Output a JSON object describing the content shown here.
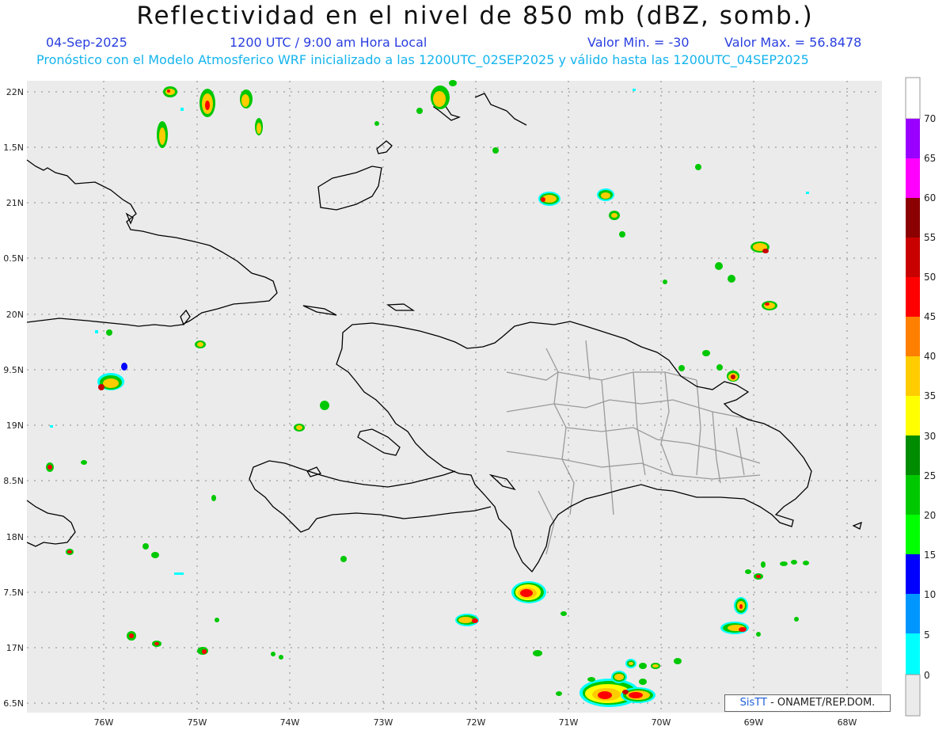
{
  "header": {
    "title": "Reflectividad en el nivel de 850 mb (dBZ, somb.)",
    "date": "04-Sep-2025",
    "time": "1200 UTC / 9:00 am Hora Local",
    "valmin": "Valor Min. = -30",
    "valmax": "Valor Max. = 56.8478",
    "forecast": "Pronóstico con el Modelo Atmosferico WRF inicializado a las 1200UTC_02SEP2025 y válido hasta las  1200UTC_04SEP2025"
  },
  "map": {
    "lat_labels": [
      "22N",
      "1.5N",
      "21N",
      "0.5N",
      "20N",
      "9.5N",
      "19N",
      "8.5N",
      "18N",
      "7.5N",
      "17N",
      "6.5N"
    ],
    "lon_labels": [
      "76W",
      "75W",
      "74W",
      "73W",
      "72W",
      "71W",
      "70W",
      "69W",
      "68W"
    ],
    "background": "#ebebeb",
    "coast_color": "#000000",
    "province_color": "#9a9a9a"
  },
  "colorbar": {
    "levels": [
      "70",
      "65",
      "60",
      "55",
      "50",
      "45",
      "40",
      "35",
      "30",
      "25",
      "20",
      "15",
      "10",
      "5",
      "0"
    ],
    "colors": [
      "#9a00ff",
      "#ff00ff",
      "#8b0000",
      "#c80000",
      "#ff0000",
      "#ff7f00",
      "#ffcc00",
      "#ffff00",
      "#008c00",
      "#00c800",
      "#00ff00",
      "#0000ff",
      "#0096ff",
      "#00ffff",
      "#ebebeb"
    ]
  },
  "credit": {
    "brand": "SisTT",
    "text": " - ONAMET/REP.DOM."
  }
}
